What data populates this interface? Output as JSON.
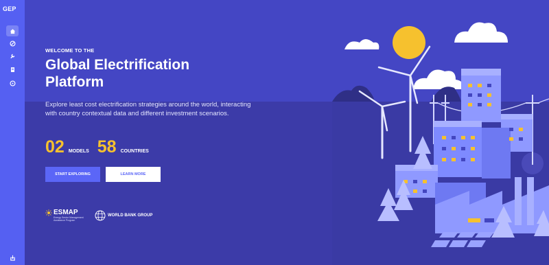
{
  "app": {
    "brand": "GEP"
  },
  "sidebar": {
    "items": [
      {
        "name": "home",
        "icon": "home-icon",
        "active": true
      },
      {
        "name": "compass",
        "icon": "compass-icon",
        "active": false
      },
      {
        "name": "tools",
        "icon": "wrench-icon",
        "active": false
      },
      {
        "name": "documents",
        "icon": "document-icon",
        "active": false
      },
      {
        "name": "info",
        "icon": "info-icon",
        "active": false
      }
    ],
    "bottom_icon": "login-icon"
  },
  "hero": {
    "eyebrow": "WELCOME TO THE",
    "title": "Global Electrification Platform",
    "description": "Explore least cost electrification strategies around the world, interacting with country contextual data and different investment scenarios."
  },
  "stats": [
    {
      "value": "02",
      "label": "MODELS"
    },
    {
      "value": "58",
      "label": "COUNTRIES"
    }
  ],
  "buttons": {
    "primary_label": "START EXPLORING",
    "secondary_label": "LEARN MORE"
  },
  "partners": {
    "esmap_name": "ESMAP",
    "esmap_tagline": "Energy Sector Management Assistance Program",
    "wbg_name": "WORLD BANK GROUP"
  },
  "colors": {
    "accent": "#5b66f7",
    "highlight": "#f6c12e",
    "background": "#4446c4",
    "sidebar": "#5560f2"
  }
}
